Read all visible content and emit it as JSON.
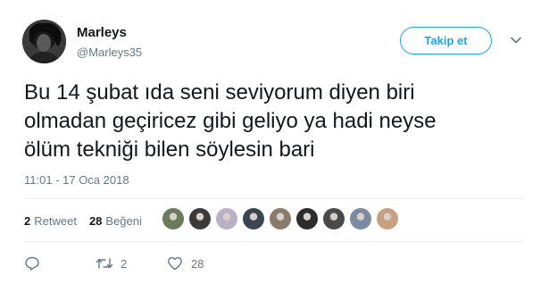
{
  "user": {
    "name": "Marleys",
    "handle": "@Marleys35"
  },
  "follow_label": "Takip et",
  "tweet_lines": [
    "Bu 14 şubat ıda seni seviyorum diyen biri",
    "olmadan geçiricez gibi geliyo ya hadi neyse",
    "ölüm tekniği bilen söylesin bari"
  ],
  "timestamp": "11:01 - 17 Oca 2018",
  "stats": {
    "retweets_count": "2",
    "retweets_label": "Retweet",
    "likes_count": "28",
    "likes_label": "Beğeni"
  },
  "liker_avatar_colors": [
    "#6a7a5a",
    "#3a3a3a",
    "#b9b0c8",
    "#3c4650",
    "#8a7a6a",
    "#2c2c2c",
    "#4a4a4a",
    "#7a8aa0",
    "#c8a080"
  ],
  "actions": {
    "reply_icon": "reply-icon",
    "retweet_count": "2",
    "like_count": "28"
  },
  "colors": {
    "accent": "#1da1f2",
    "secondary_text": "#657786",
    "divider": "#e6ecf0"
  }
}
